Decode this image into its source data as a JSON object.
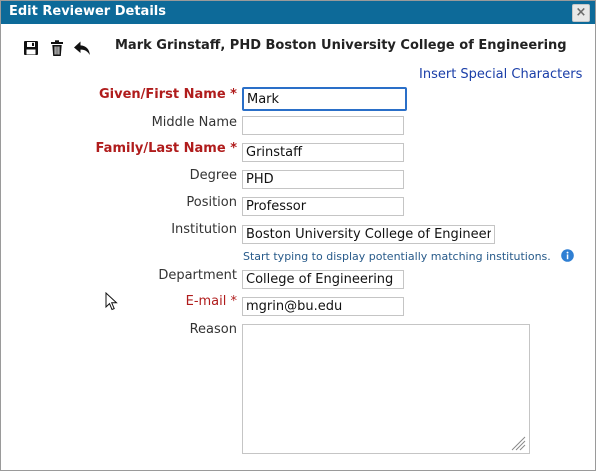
{
  "dialog": {
    "title": "Edit Reviewer Details",
    "close_glyph": "×"
  },
  "toolbar": {
    "icons": [
      "save-icon",
      "trash-icon",
      "reply-back-icon"
    ]
  },
  "header": {
    "title": "Mark Grinstaff, PHD Boston University College of Engineering"
  },
  "special_chars_link": "Insert Special Characters",
  "form": {
    "given_name": {
      "label": "Given/First Name *",
      "value": "Mark"
    },
    "middle_name": {
      "label": "Middle Name",
      "value": ""
    },
    "family_name": {
      "label": "Family/Last Name *",
      "value": "Grinstaff"
    },
    "degree": {
      "label": "Degree",
      "value": "PHD"
    },
    "position": {
      "label": "Position",
      "value": "Professor"
    },
    "institution": {
      "label": "Institution",
      "value": "Boston University College of Engineerin",
      "hint": "Start typing to display potentially matching institutions."
    },
    "department": {
      "label": "Department",
      "value": "College of Engineering"
    },
    "email": {
      "label": "E-mail *",
      "value": "mgrin@bu.edu"
    },
    "reason": {
      "label": "Reason",
      "value": ""
    }
  },
  "colors": {
    "titlebar": "#0d6a99",
    "required_label": "#b01c1c",
    "link": "#1a3ea8",
    "focus_border": "#2a6fc8"
  }
}
